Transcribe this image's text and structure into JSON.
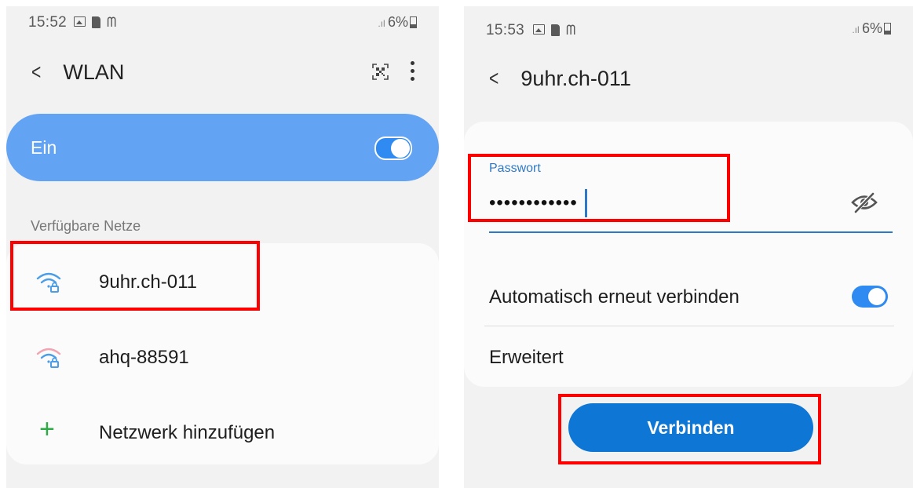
{
  "left_screen": {
    "status": {
      "time": "15:52",
      "battery": "6%"
    },
    "title": "WLAN",
    "wifi_toggle": {
      "label": "Ein",
      "on": true
    },
    "section_title": "Verfügbare Netze",
    "networks": [
      {
        "name": "9uhr.ch-011",
        "signal": "strong"
      },
      {
        "name": "ahq-88591",
        "signal": "weak"
      }
    ],
    "add_network_label": "Netzwerk hinzufügen"
  },
  "right_screen": {
    "status": {
      "time": "15:53",
      "battery": "6%"
    },
    "title": "9uhr.ch-011",
    "password_label": "Passwort",
    "password_value": "••••••••••••",
    "auto_reconnect_label": "Automatisch erneut verbinden",
    "auto_reconnect_on": true,
    "advanced_label": "Erweitert",
    "connect_button": "Verbinden"
  },
  "colors": {
    "accent": "#0e77d6",
    "toggle": "#2f8bf2",
    "highlight": "#ff0000",
    "ein_card": "#63a3f4"
  }
}
